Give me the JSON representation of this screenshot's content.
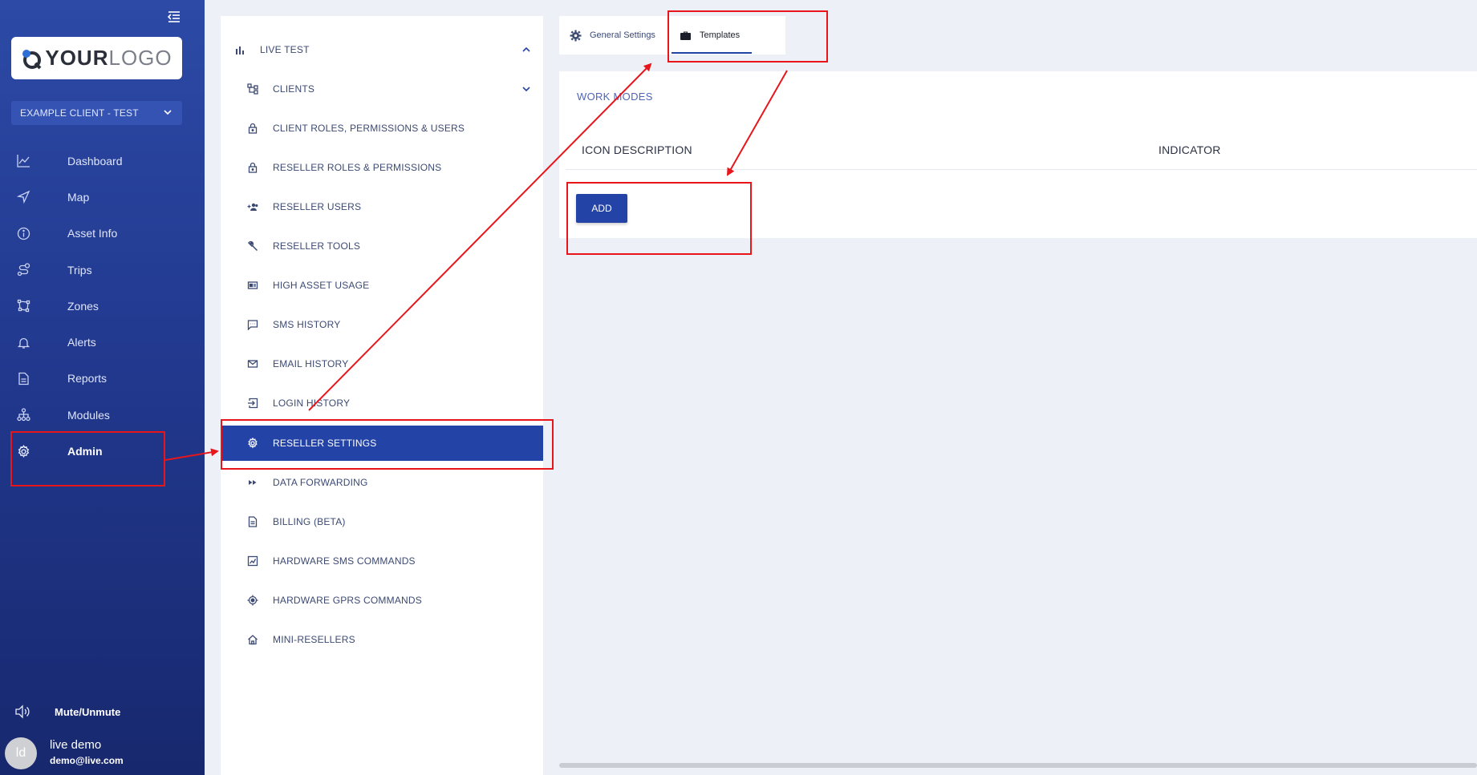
{
  "sidebar": {
    "logo": {
      "strong": "YOUR",
      "light": "LOGO"
    },
    "client_select": "EXAMPLE CLIENT - TEST",
    "nav": [
      {
        "label": "Dashboard",
        "icon": "chart-line-icon"
      },
      {
        "label": "Map",
        "icon": "navigation-icon"
      },
      {
        "label": "Asset Info",
        "icon": "info-icon"
      },
      {
        "label": "Trips",
        "icon": "route-icon"
      },
      {
        "label": "Zones",
        "icon": "zone-icon"
      },
      {
        "label": "Alerts",
        "icon": "bell-icon"
      },
      {
        "label": "Reports",
        "icon": "document-icon"
      },
      {
        "label": "Modules",
        "icon": "modules-icon"
      },
      {
        "label": "Admin",
        "icon": "gear-icon",
        "active": true
      }
    ],
    "mute_label": "Mute/Unmute",
    "user": {
      "initials": "ld",
      "name": "live demo",
      "email": "demo@live.com"
    }
  },
  "settings_menu": {
    "section": "LIVE TEST",
    "items": [
      {
        "label": "CLIENTS",
        "icon": "hierarchy-icon",
        "expandable": true
      },
      {
        "label": "CLIENT ROLES, PERMISSIONS & USERS",
        "icon": "lock-icon"
      },
      {
        "label": "RESELLER ROLES & PERMISSIONS",
        "icon": "lock-icon"
      },
      {
        "label": "RESELLER USERS",
        "icon": "users-add-icon"
      },
      {
        "label": "RESELLER TOOLS",
        "icon": "wrench-icon"
      },
      {
        "label": "HIGH ASSET USAGE",
        "icon": "card-icon"
      },
      {
        "label": "SMS HISTORY",
        "icon": "message-icon"
      },
      {
        "label": "EMAIL HISTORY",
        "icon": "mail-icon"
      },
      {
        "label": "LOGIN HISTORY",
        "icon": "login-icon"
      },
      {
        "label": "RESELLER SETTINGS",
        "icon": "gear-icon",
        "selected": true
      },
      {
        "label": "DATA FORWARDING",
        "icon": "fast-forward-icon"
      },
      {
        "label": "BILLING (BETA)",
        "icon": "document-icon"
      },
      {
        "label": "HARDWARE SMS COMMANDS",
        "icon": "chart-box-icon"
      },
      {
        "label": "HARDWARE GPRS COMMANDS",
        "icon": "target-icon"
      },
      {
        "label": "MINI-RESELLERS",
        "icon": "home-icon"
      }
    ]
  },
  "tabs": [
    {
      "label": "General Settings",
      "icon": "gear-icon"
    },
    {
      "label": "Templates",
      "icon": "briefcase-icon",
      "active": true
    }
  ],
  "content": {
    "section_title": "WORK MODES",
    "columns": [
      "ICON DESCRIPTION",
      "INDICATOR"
    ],
    "add_label": "ADD"
  },
  "colors": {
    "sidebar_top": "#2c4aa6",
    "sidebar_bottom": "#17286e",
    "accent": "#2443a6",
    "annotation": "#e8161b",
    "background": "#eef0f7"
  }
}
